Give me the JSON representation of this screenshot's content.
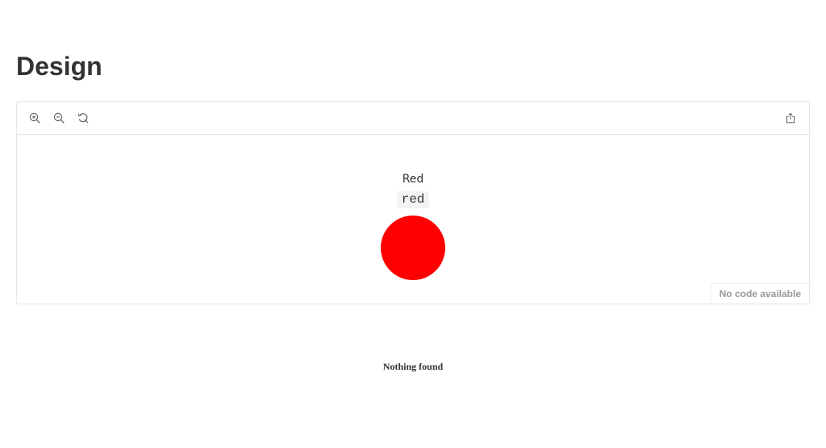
{
  "page": {
    "title": "Design"
  },
  "preview": {
    "toolbar": {
      "zoom_in_icon": "zoom-in-icon",
      "zoom_out_icon": "zoom-out-icon",
      "reset_icon": "reset-icon",
      "share_icon": "share-icon"
    },
    "swatch": {
      "name": "Red",
      "token": "red",
      "color": "#ff0000"
    },
    "no_code_label": "No code available"
  },
  "empty_state": {
    "message": "Nothing found"
  },
  "colors": {
    "text": "#333333",
    "border": "#e6e6e6",
    "muted": "#999999",
    "icon": "#666666"
  }
}
